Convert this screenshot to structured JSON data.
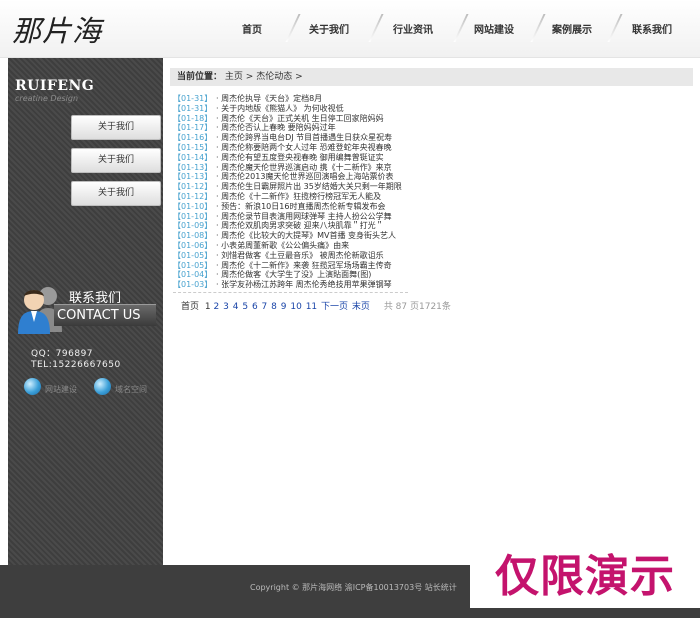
{
  "site": {
    "logo": "那片海"
  },
  "nav": [
    "首页",
    "关于我们",
    "行业资讯",
    "网站建设",
    "案例展示",
    "联系我们"
  ],
  "sidebar": {
    "brand": "RUIFENG",
    "brand_sub": "creatine Design",
    "buttons": [
      "关于我们",
      "关于我们",
      "关于我们"
    ],
    "contact_cn": "联系我们",
    "contact_en": "CONTACT US",
    "qq": "QQ：796897",
    "tel": "TEL:15226667650",
    "links": [
      "网站建设",
      "域名空间"
    ]
  },
  "breadcrumb": {
    "label": "当前位置：",
    "home": "主页",
    "sep": ">",
    "current": "杰伦动态",
    "tail": ">"
  },
  "news": [
    {
      "date": "【01-31】",
      "title": "· 周杰伦执导《天台》定档8月"
    },
    {
      "date": "【01-31】",
      "title": "· 关于内地版《熊猫人》 为何收视低"
    },
    {
      "date": "【01-18】",
      "title": "· 周杰伦《天台》正式关机 生日停工回家陪妈妈"
    },
    {
      "date": "【01-17】",
      "title": "· 周杰伦否认上春晚 要陪妈妈过年"
    },
    {
      "date": "【01-16】",
      "title": "· 周杰伦跨界当电台DJ 节目首播遇生日获众星祝寿"
    },
    {
      "date": "【01-15】",
      "title": "· 周杰伦称要陪两个女人过年 恐难登蛇年央视春晚"
    },
    {
      "date": "【01-14】",
      "title": "· 周杰伦有望五度登央视春晚 御用编舞曾铤证实"
    },
    {
      "date": "【01-13】",
      "title": "· 周杰伦魔天伦世界巡演启动 携《十二新作》来京"
    },
    {
      "date": "【01-13】",
      "title": "· 周杰伦2013魔天伦世界巡回演唱会上海站票价表"
    },
    {
      "date": "【01-12】",
      "title": "· 周杰伦生日霸屏照片出 35岁结婚大关只剩一年期限"
    },
    {
      "date": "【01-12】",
      "title": "· 周杰伦《十二新作》狂揽榜行榜冠军无人能及"
    },
    {
      "date": "【01-10】",
      "title": "· 预告：新浪10日16时直播周杰伦新专辑发布会"
    },
    {
      "date": "【01-10】",
      "title": "· 周杰伦录节目表演用网球弹琴 主持人扮公公学舞"
    },
    {
      "date": "【01-09】",
      "title": "· 周杰伦双肌肉男求突破 迎来八块肌靠＂打光＂"
    },
    {
      "date": "【01-08】",
      "title": "· 周杰伦《比较大的大提琴》MV首播 变身街头艺人"
    },
    {
      "date": "【01-06】",
      "title": "· 小表弟周董新歌《公公偏头痛》由来"
    },
    {
      "date": "【01-05】",
      "title": "· 刘惜君做客《土豆最音乐》 被周杰伦新歌诅乐"
    },
    {
      "date": "【01-05】",
      "title": "· 周杰伦《十二新作》来袭 狂揽冠军场场霸主传奇"
    },
    {
      "date": "【01-04】",
      "title": "· 周杰伦做客《大学生了没》上演貼面舞(图)"
    },
    {
      "date": "【01-03】",
      "title": "· 张学友孙杨江苏跨年 周杰伦秀绝技用苹果弹钢琴"
    }
  ],
  "pager": {
    "first": "首页",
    "current": "1",
    "pages": [
      "2",
      "3",
      "4",
      "5",
      "6",
      "7",
      "8",
      "9",
      "10",
      "11"
    ],
    "next": "下一页",
    "last": "末页",
    "info": "共 87 页1721条"
  },
  "footer": {
    "text": "Copyright © 那片海网络 渝ICP备10013703号 站长统计"
  },
  "watermark": "仅限演示",
  "colors": {
    "news_date": "#4aa3cf",
    "pager_link": "#1a45a8",
    "watermark": "#c4136d",
    "sidebar_bg": "#444444"
  }
}
